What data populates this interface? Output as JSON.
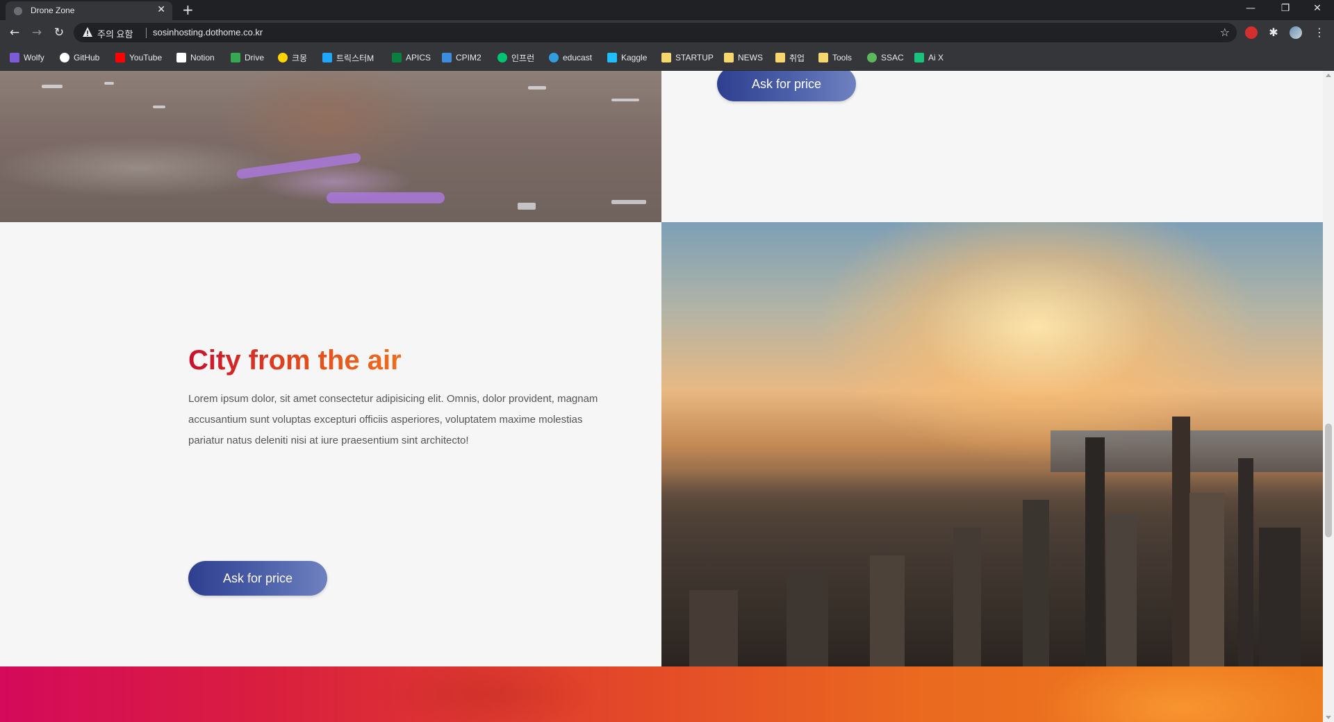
{
  "browser": {
    "tab_title": "Drone Zone",
    "tab_close": "✕",
    "new_tab": "+",
    "window_controls": {
      "minimize": "—",
      "restore": "❐",
      "close": "✕"
    },
    "nav": {
      "back": "←",
      "forward": "→",
      "reload": "↻"
    },
    "security_warning": "주의 요함",
    "url": "sosinhosting.dothome.co.kr",
    "star": "☆",
    "menu": "⋮",
    "bookmarks": [
      {
        "label": "Wolfy",
        "icon": "wolfy-icon",
        "color": "#7b5cd6"
      },
      {
        "label": "GitHub",
        "icon": "github-icon",
        "color": "#ffffff"
      },
      {
        "label": "YouTube",
        "icon": "youtube-icon",
        "color": "#ff0000"
      },
      {
        "label": "Notion",
        "icon": "notion-icon",
        "color": "#ffffff"
      },
      {
        "label": "Drive",
        "icon": "drive-icon",
        "color": "#34a853"
      },
      {
        "label": "크몽",
        "icon": "kmong-icon",
        "color": "#ffd400"
      },
      {
        "label": "트릭스터M",
        "icon": "trickster-icon",
        "color": "#1ea7fd"
      },
      {
        "label": "APICS",
        "icon": "apics-icon",
        "color": "#0a7f3f"
      },
      {
        "label": "CPIM2",
        "icon": "cpim-icon",
        "color": "#3c8dde"
      },
      {
        "label": "인프런",
        "icon": "inflearn-icon",
        "color": "#00c471"
      },
      {
        "label": "educast",
        "icon": "educast-icon",
        "color": "#2f9de0"
      },
      {
        "label": "Kaggle",
        "icon": "kaggle-icon",
        "color": "#20beff"
      },
      {
        "label": "STARTUP",
        "icon": "folder-icon",
        "color": "#f5d76e"
      },
      {
        "label": "NEWS",
        "icon": "folder-icon",
        "color": "#f5d76e"
      },
      {
        "label": "취업",
        "icon": "folder-icon",
        "color": "#f5d76e"
      },
      {
        "label": "Tools",
        "icon": "folder-icon",
        "color": "#f5d76e"
      },
      {
        "label": "SSAC",
        "icon": "ssac-icon",
        "color": "#5bb85b"
      },
      {
        "label": "Ai X",
        "icon": "aix-icon",
        "color": "#19c37d"
      }
    ]
  },
  "page": {
    "top_button": "Ask for price",
    "section": {
      "title": "City from the air",
      "body": "Lorem ipsum dolor, sit amet consectetur adipisicing elit. Omnis, dolor provident, magnam accusantium sunt voluptas excepturi officiis asperiores, voluptatem maxime molestias pariatur natus deleniti nisi at iure praesentium sint architecto!",
      "button": "Ask for price"
    }
  },
  "colors": {
    "heading_start": "#c8102e",
    "heading_end": "#ef6d1f",
    "button_start": "#2e3f8f",
    "button_end": "#6f81bf",
    "banner_start": "#d40a5a",
    "banner_end": "#ee7d1e"
  }
}
